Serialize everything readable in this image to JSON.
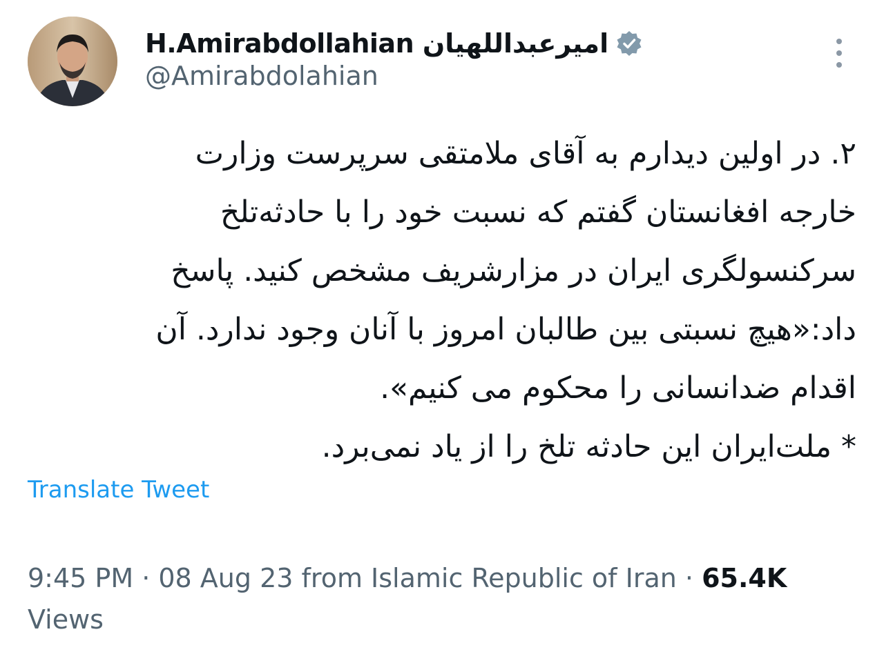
{
  "author": {
    "display_name": "H.Amirabdollahian امیرعبداللهیان",
    "handle": "@Amirabdolahian",
    "verified_icon": "verified-badge-icon",
    "avatar_icon": "profile-photo"
  },
  "tweet": {
    "lines": [
      "۲. در اولین دیدارم به آقای ملامتقی سرپرست وزارت",
      "خارجه افغانستان گفتم که نسبت خود را با حادثه‌تلخ",
      "سرکنسولگری ایران در مزارشریف مشخص کنید. پاسخ",
      "داد:«هیچ نسبتی بین طالبان امروز با آنان وجود ندارد. آن",
      "اقدام ضدانسانی را محکوم می کنیم».",
      "* ملت‌ایران این حادثه تلخ را از یاد نمی‌برد."
    ]
  },
  "translate_label": "Translate Tweet",
  "meta": {
    "time": "9:45 PM",
    "separator": " · ",
    "date": "08 Aug 23",
    "source": " from Islamic Republic of Iran",
    "views_count": "65.4K",
    "views_label": "Views"
  },
  "more_icon": "more-vertical-icon",
  "colors": {
    "accent": "#1d9bf0",
    "secondary_text": "#536471",
    "primary_text": "#0f1419",
    "verified_badge": "#829aab"
  }
}
